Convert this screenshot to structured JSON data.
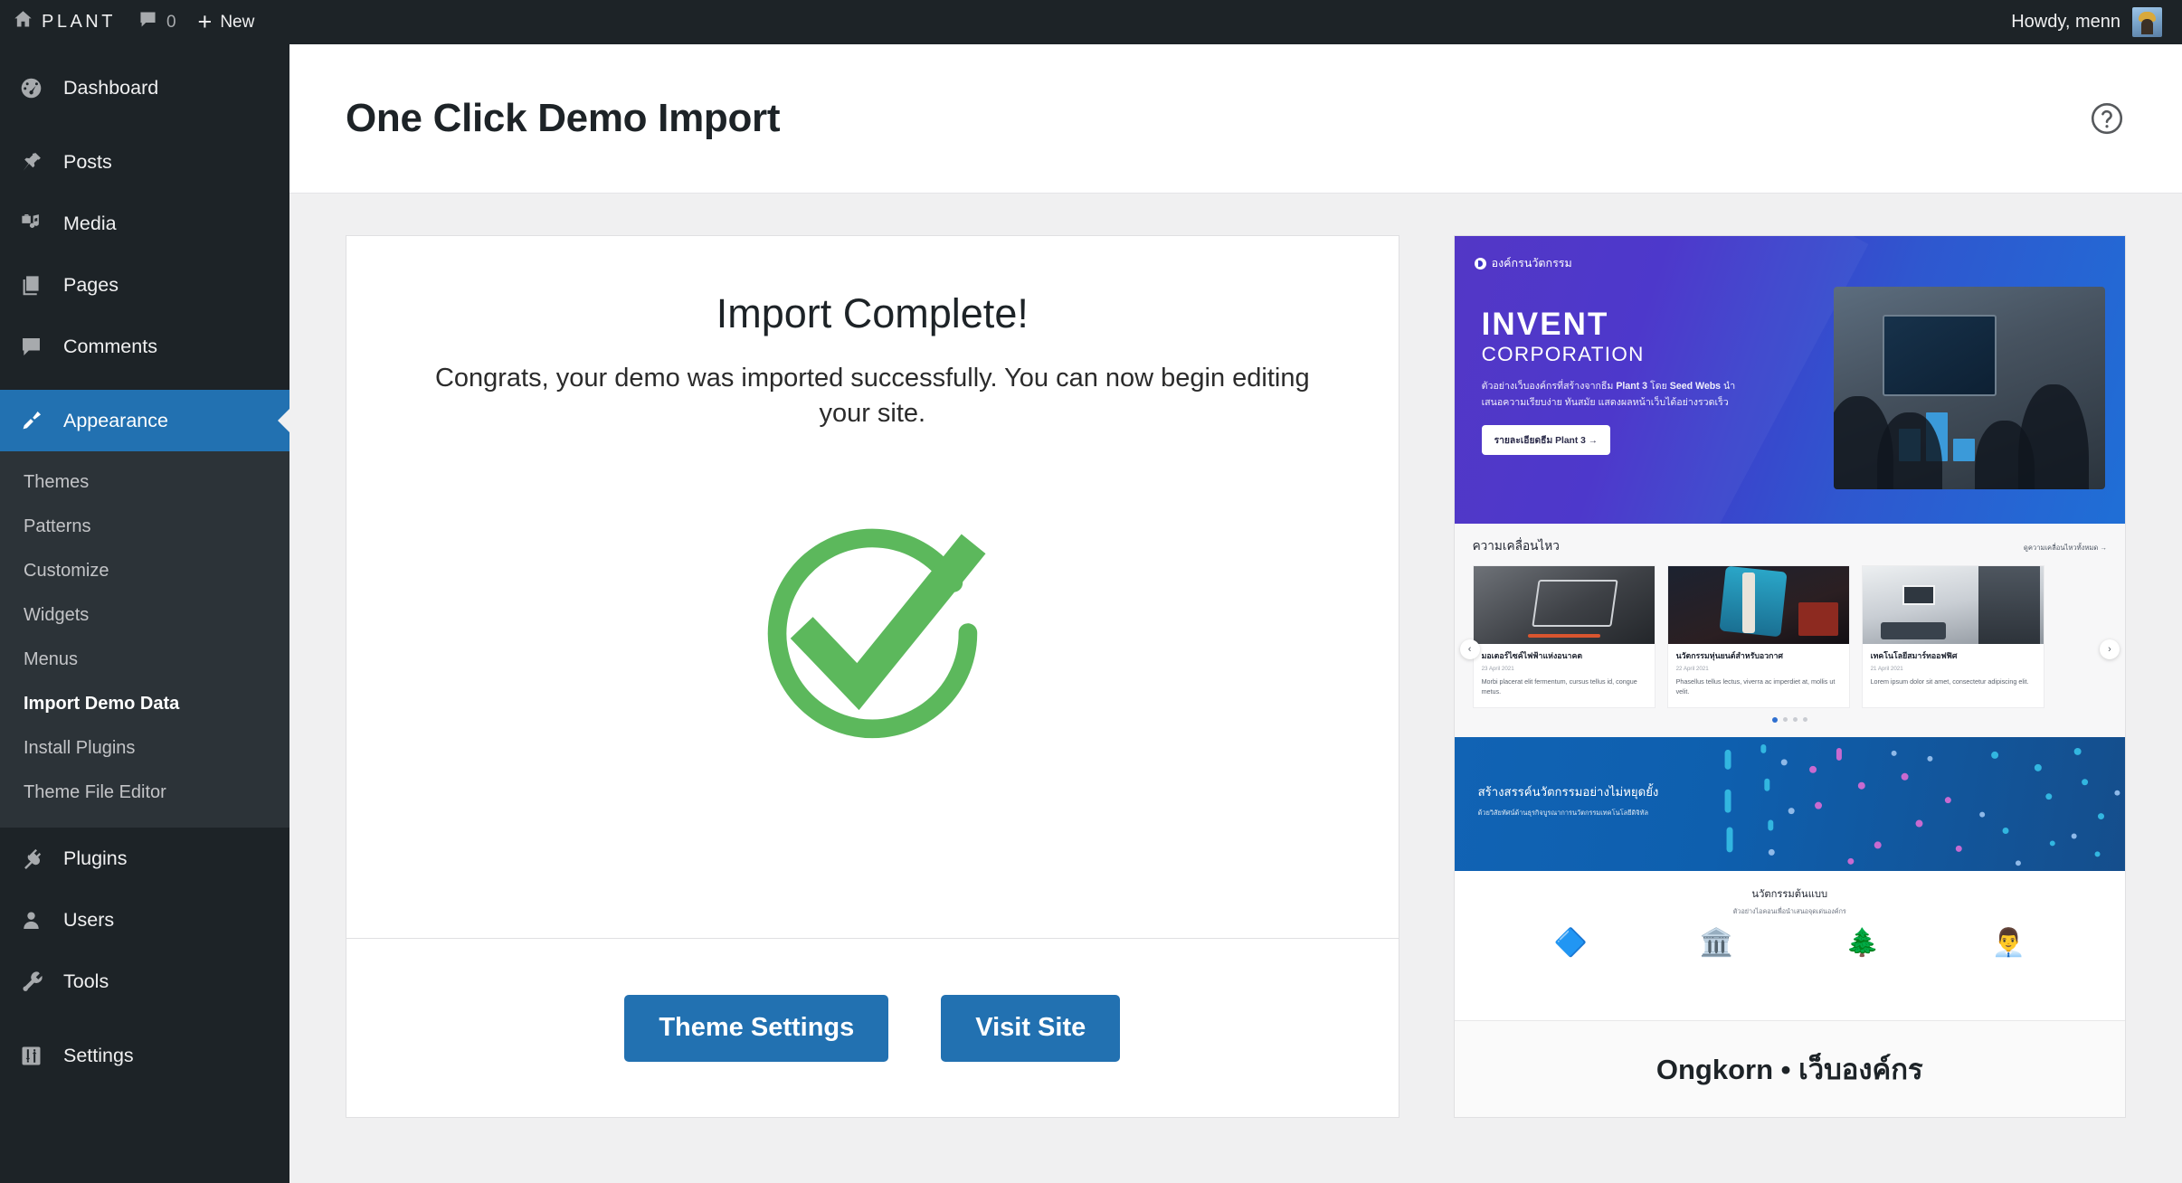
{
  "adminbar": {
    "home_icon": "home-icon",
    "site_name": "PLANT",
    "comments_icon": "comment-bubble-icon",
    "comments_count": "0",
    "new_plus": "+",
    "new_label": "New",
    "howdy": "Howdy, menn",
    "avatar": "user-avatar"
  },
  "sidebar": {
    "items": [
      {
        "label": "Dashboard",
        "icon": "dashboard-icon"
      },
      {
        "label": "Posts",
        "icon": "pin-icon"
      },
      {
        "label": "Media",
        "icon": "media-icon"
      },
      {
        "label": "Pages",
        "icon": "pages-icon"
      },
      {
        "label": "Comments",
        "icon": "comment-bubble-icon"
      },
      {
        "label": "Appearance",
        "icon": "paintbrush-icon"
      },
      {
        "label": "Plugins",
        "icon": "plug-icon"
      },
      {
        "label": "Users",
        "icon": "user-icon"
      },
      {
        "label": "Tools",
        "icon": "wrench-icon"
      },
      {
        "label": "Settings",
        "icon": "sliders-icon"
      }
    ],
    "submenu": [
      {
        "label": "Themes"
      },
      {
        "label": "Patterns"
      },
      {
        "label": "Customize"
      },
      {
        "label": "Widgets"
      },
      {
        "label": "Menus"
      },
      {
        "label": "Import Demo Data"
      },
      {
        "label": "Install Plugins"
      },
      {
        "label": "Theme File Editor"
      }
    ],
    "current_item": "Appearance",
    "current_subitem": "Import Demo Data"
  },
  "header": {
    "title": "One Click Demo Import",
    "help_icon": "help-circle-icon"
  },
  "import_card": {
    "heading": "Import Complete!",
    "message": "Congrats, your demo was imported successfully. You can now begin editing your site.",
    "success_icon": "check-circle-icon",
    "success_color": "#5cb85c",
    "buttons": [
      {
        "label": "Theme Settings",
        "name": "theme-settings-button"
      },
      {
        "label": "Visit Site",
        "name": "visit-site-button"
      }
    ]
  },
  "preview": {
    "title": "Ongkorn • เว็บองค์กร",
    "hero": {
      "logo_text": "องค์กรนวัตกรรม",
      "brand_line1": "INVENT",
      "brand_line2": "CORPORATION",
      "description_pre": "ตัวอย่างเว็บองค์กรที่สร้างจากธีม ",
      "description_b1": "Plant 3",
      "description_mid": " โดย ",
      "description_b2": "Seed Webs",
      "description_post": " นำเสนอความเรียบง่าย ทันสมัย แสดงผลหน้าเว็บได้อย่างรวดเร็ว",
      "button_label": "รายละเอียดธีม Plant 3 →"
    },
    "news": {
      "section_title": "ความเคลื่อนไหว",
      "more_link": "ดูความเคลื่อนไหวทั้งหมด →",
      "prev_icon": "chevron-left-icon",
      "next_icon": "chevron-right-icon",
      "cards": [
        {
          "title": "มอเตอร์ไซค์ไฟฟ้าแห่งอนาคต",
          "date": "23 April 2021",
          "text": "Morbi placerat elit fermentum, cursus tellus id, congue metus."
        },
        {
          "title": "นวัตกรรมหุ่นยนต์สำหรับอวกาศ",
          "date": "22 April 2021",
          "text": "Phasellus tellus lectus, viverra ac imperdiet at, mollis ut velit."
        },
        {
          "title": "เทคโนโลยีสมาร์ทออฟฟิศ",
          "date": "21 April 2021",
          "text": "Lorem ipsum dolor sit amet, consectetur adipiscing elit."
        }
      ]
    },
    "banner": {
      "title": "สร้างสรรค์นวัตกรรมอย่างไม่หยุดยั้ง",
      "subtitle": "ด้วยวิสัยทัศน์ด้านธุรกิจบูรณาการนวัตกรรมเทคโนโลยีดิจิทัล"
    },
    "icons_section": {
      "title": "นวัตกรรมต้นแบบ",
      "subtitle": "ตัวอย่างไอคอนเพื่อนำเสนอจุดเด่นองค์กร",
      "icons": [
        "🔷",
        "🏛️",
        "🌲",
        "👨‍💼"
      ]
    }
  },
  "colors": {
    "admin_dark": "#1d2327",
    "submenu_dark": "#2c3338",
    "accent_blue": "#2271b1",
    "success_green": "#5cb85c",
    "page_bg": "#f0f0f1"
  }
}
